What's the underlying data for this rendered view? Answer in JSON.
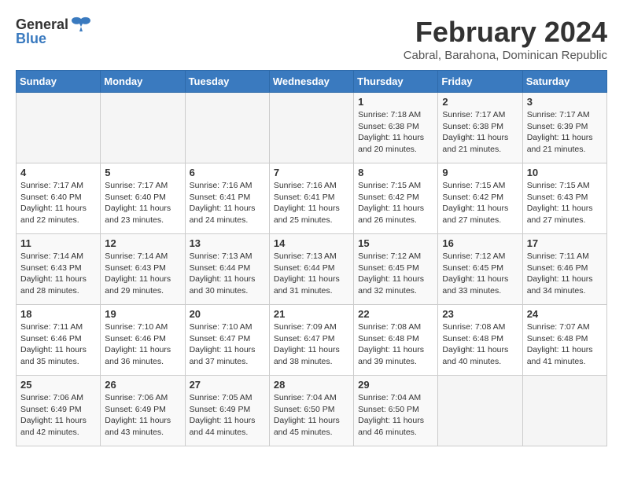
{
  "logo": {
    "general": "General",
    "blue": "Blue",
    "bird_unicode": "🐦"
  },
  "title": "February 2024",
  "subtitle": "Cabral, Barahona, Dominican Republic",
  "days_of_week": [
    "Sunday",
    "Monday",
    "Tuesday",
    "Wednesday",
    "Thursday",
    "Friday",
    "Saturday"
  ],
  "weeks": [
    [
      {
        "day": "",
        "info": ""
      },
      {
        "day": "",
        "info": ""
      },
      {
        "day": "",
        "info": ""
      },
      {
        "day": "",
        "info": ""
      },
      {
        "day": "1",
        "info": "Sunrise: 7:18 AM\nSunset: 6:38 PM\nDaylight: 11 hours and 20 minutes."
      },
      {
        "day": "2",
        "info": "Sunrise: 7:17 AM\nSunset: 6:38 PM\nDaylight: 11 hours and 21 minutes."
      },
      {
        "day": "3",
        "info": "Sunrise: 7:17 AM\nSunset: 6:39 PM\nDaylight: 11 hours and 21 minutes."
      }
    ],
    [
      {
        "day": "4",
        "info": "Sunrise: 7:17 AM\nSunset: 6:40 PM\nDaylight: 11 hours and 22 minutes."
      },
      {
        "day": "5",
        "info": "Sunrise: 7:17 AM\nSunset: 6:40 PM\nDaylight: 11 hours and 23 minutes."
      },
      {
        "day": "6",
        "info": "Sunrise: 7:16 AM\nSunset: 6:41 PM\nDaylight: 11 hours and 24 minutes."
      },
      {
        "day": "7",
        "info": "Sunrise: 7:16 AM\nSunset: 6:41 PM\nDaylight: 11 hours and 25 minutes."
      },
      {
        "day": "8",
        "info": "Sunrise: 7:15 AM\nSunset: 6:42 PM\nDaylight: 11 hours and 26 minutes."
      },
      {
        "day": "9",
        "info": "Sunrise: 7:15 AM\nSunset: 6:42 PM\nDaylight: 11 hours and 27 minutes."
      },
      {
        "day": "10",
        "info": "Sunrise: 7:15 AM\nSunset: 6:43 PM\nDaylight: 11 hours and 27 minutes."
      }
    ],
    [
      {
        "day": "11",
        "info": "Sunrise: 7:14 AM\nSunset: 6:43 PM\nDaylight: 11 hours and 28 minutes."
      },
      {
        "day": "12",
        "info": "Sunrise: 7:14 AM\nSunset: 6:43 PM\nDaylight: 11 hours and 29 minutes."
      },
      {
        "day": "13",
        "info": "Sunrise: 7:13 AM\nSunset: 6:44 PM\nDaylight: 11 hours and 30 minutes."
      },
      {
        "day": "14",
        "info": "Sunrise: 7:13 AM\nSunset: 6:44 PM\nDaylight: 11 hours and 31 minutes."
      },
      {
        "day": "15",
        "info": "Sunrise: 7:12 AM\nSunset: 6:45 PM\nDaylight: 11 hours and 32 minutes."
      },
      {
        "day": "16",
        "info": "Sunrise: 7:12 AM\nSunset: 6:45 PM\nDaylight: 11 hours and 33 minutes."
      },
      {
        "day": "17",
        "info": "Sunrise: 7:11 AM\nSunset: 6:46 PM\nDaylight: 11 hours and 34 minutes."
      }
    ],
    [
      {
        "day": "18",
        "info": "Sunrise: 7:11 AM\nSunset: 6:46 PM\nDaylight: 11 hours and 35 minutes."
      },
      {
        "day": "19",
        "info": "Sunrise: 7:10 AM\nSunset: 6:46 PM\nDaylight: 11 hours and 36 minutes."
      },
      {
        "day": "20",
        "info": "Sunrise: 7:10 AM\nSunset: 6:47 PM\nDaylight: 11 hours and 37 minutes."
      },
      {
        "day": "21",
        "info": "Sunrise: 7:09 AM\nSunset: 6:47 PM\nDaylight: 11 hours and 38 minutes."
      },
      {
        "day": "22",
        "info": "Sunrise: 7:08 AM\nSunset: 6:48 PM\nDaylight: 11 hours and 39 minutes."
      },
      {
        "day": "23",
        "info": "Sunrise: 7:08 AM\nSunset: 6:48 PM\nDaylight: 11 hours and 40 minutes."
      },
      {
        "day": "24",
        "info": "Sunrise: 7:07 AM\nSunset: 6:48 PM\nDaylight: 11 hours and 41 minutes."
      }
    ],
    [
      {
        "day": "25",
        "info": "Sunrise: 7:06 AM\nSunset: 6:49 PM\nDaylight: 11 hours and 42 minutes."
      },
      {
        "day": "26",
        "info": "Sunrise: 7:06 AM\nSunset: 6:49 PM\nDaylight: 11 hours and 43 minutes."
      },
      {
        "day": "27",
        "info": "Sunrise: 7:05 AM\nSunset: 6:49 PM\nDaylight: 11 hours and 44 minutes."
      },
      {
        "day": "28",
        "info": "Sunrise: 7:04 AM\nSunset: 6:50 PM\nDaylight: 11 hours and 45 minutes."
      },
      {
        "day": "29",
        "info": "Sunrise: 7:04 AM\nSunset: 6:50 PM\nDaylight: 11 hours and 46 minutes."
      },
      {
        "day": "",
        "info": ""
      },
      {
        "day": "",
        "info": ""
      }
    ]
  ]
}
